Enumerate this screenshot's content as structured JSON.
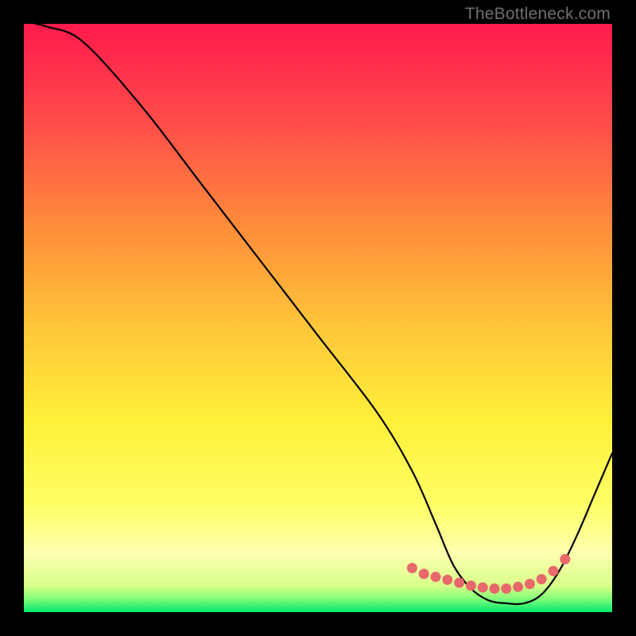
{
  "watermark": "TheBottleneck.com",
  "colors": {
    "background_black": "#000000",
    "gradient_top": "#ff1a4d",
    "gradient_mid_upper": "#ff7a3a",
    "gradient_mid": "#ffd63a",
    "gradient_mid_lower": "#ffff66",
    "gradient_near_bottom": "#e8ff7a",
    "gradient_bottom": "#00e86b",
    "curve": "#000000",
    "dots": "#e8696b"
  },
  "chart_data": {
    "type": "line",
    "title": "",
    "xlabel": "",
    "ylabel": "",
    "xlim": [
      0,
      100
    ],
    "ylim": [
      0,
      100
    ],
    "series": [
      {
        "name": "bottleneck-curve",
        "x": [
          2,
          4,
          10,
          20,
          30,
          40,
          50,
          60,
          66,
          70,
          73,
          76,
          79,
          82,
          85,
          88,
          91,
          94,
          97,
          100
        ],
        "values": [
          100,
          99.5,
          97,
          86,
          73,
          60,
          47,
          34,
          24,
          15,
          8,
          4,
          2,
          1.5,
          1.5,
          3,
          7,
          13,
          20,
          27
        ]
      },
      {
        "name": "highlight-dots",
        "x": [
          66,
          68,
          70,
          72,
          74,
          76,
          78,
          80,
          82,
          84,
          86,
          88,
          90,
          92
        ],
        "values": [
          7.5,
          6.5,
          6,
          5.5,
          5,
          4.5,
          4.2,
          4,
          4,
          4.3,
          4.8,
          5.6,
          7,
          9
        ]
      }
    ]
  }
}
